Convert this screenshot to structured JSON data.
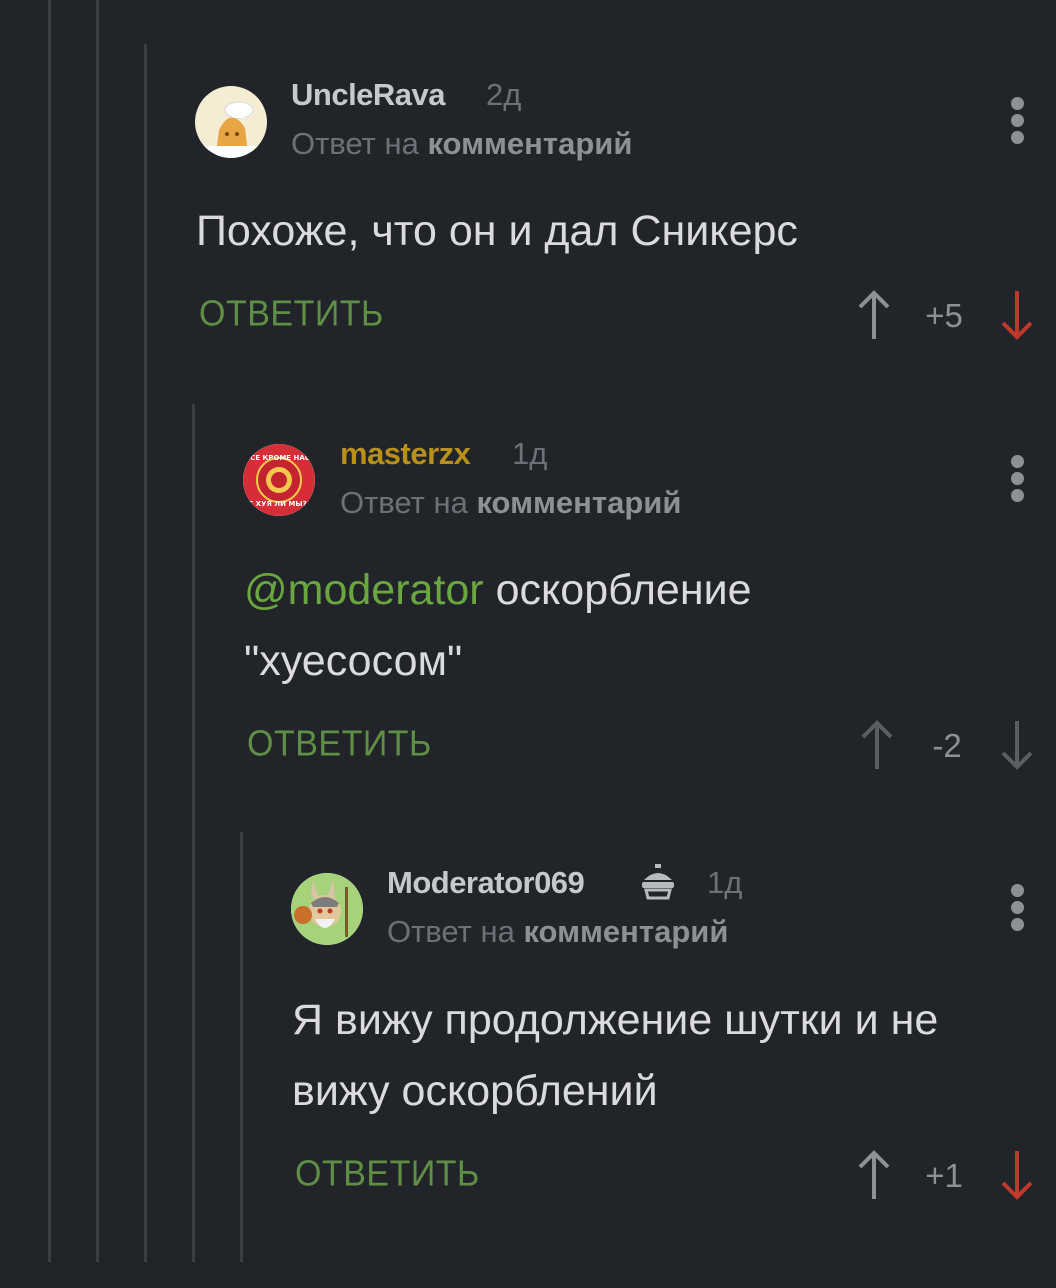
{
  "comments": [
    {
      "username": "UncleRava",
      "time": "2д",
      "reply_prefix": "Ответ на ",
      "reply_target": "комментарий",
      "text": "Похоже, что он и дал Сникерс",
      "reply_label": "ОТВЕТИТЬ",
      "rating": "+5",
      "avatar_icon": "chef-avatar-icon",
      "vote_state": "down-highlighted"
    },
    {
      "username": "masterzx",
      "time": "1д",
      "reply_prefix": "Ответ на ",
      "reply_target": "комментарий",
      "mention": "@moderator",
      "text": " оскорбление",
      "text_line2": "\"хуесосом\"",
      "reply_label": "ОТВЕТИТЬ",
      "rating": "-2",
      "avatar_icon": "red-badge-avatar-icon",
      "avatar_text_top": "ВСЕ КРОМЕ НАС!",
      "avatar_text_bottom": "С ХУЯ ЛИ МЫ?!"
    },
    {
      "username": "Moderator069",
      "time": "1д",
      "reply_prefix": "Ответ на ",
      "reply_target": "комментарий",
      "text": "Я вижу продолжение шутки и не",
      "text_line2": "вижу оскорблений",
      "reply_label": "ОТВЕТИТЬ",
      "rating": "+1",
      "avatar_icon": "bunny-warrior-avatar-icon",
      "badge_icon": "moderator-badge-icon",
      "vote_state": "down-highlighted"
    }
  ],
  "colors": {
    "background": "#212529",
    "username": "#c6c9cc",
    "username_gold": "#b8901b",
    "mention": "#6aa83f",
    "reply_button": "#5f8f45",
    "downvote_active": "#c0392b"
  }
}
